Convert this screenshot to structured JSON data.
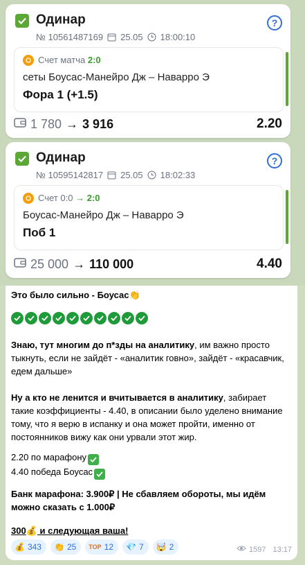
{
  "bets": [
    {
      "title": "Одинар",
      "number": "№ 10561487169",
      "date": "25.05",
      "time": "18:00:10",
      "score_label": "Счет матча",
      "score_value": "2:0",
      "event": "сеты Боусас-Манейро Дж – Наварро Э",
      "market": "Фора 1 (+1.5)",
      "stake": "1 780",
      "payout": "3 916",
      "odds": "2.20"
    },
    {
      "title": "Одинар",
      "number": "№ 10595142817",
      "date": "25.05",
      "time": "18:02:33",
      "score_label": "Счет",
      "score_from": "0:0",
      "score_value": "2:0",
      "event": "Боусас-Манейро Дж – Наварро Э",
      "market": "Поб 1",
      "stake": "25 000",
      "payout": "110 000",
      "odds": "4.40"
    }
  ],
  "message": {
    "line1": "Это было сильно - Боусас👏",
    "p1_bold": "Знаю, тут многим до п*зды на аналитику",
    "p1_rest": ", им важно просто тыкнуть, если не зайдёт - «аналитик говно», зайдёт - «красавчик, едем дальше»",
    "p2_bold": "Ну а кто не ленится и вчитывается в аналитику",
    "p2_rest": ", забирает такие коэффициенты - 4.40, в описании было уделено внимание тому, что я верю в испанку и она может пройти, именно от постоянников вижу как они урвали этот жир.",
    "marathon": "2.20 по марафону",
    "win": "4.40 победа Боусас",
    "bank": "Банк марафона: 3.900₽ | Не сбавляем обороты, мы идём можно сказать с 1.000₽",
    "cta_num": "300",
    "cta_text": " и следующая ваша!"
  },
  "reactions": [
    {
      "icon": "money-bag-icon",
      "count": "343"
    },
    {
      "icon": "clap-icon",
      "count": "25"
    },
    {
      "icon": "top-icon",
      "count": "12"
    },
    {
      "icon": "gem-icon",
      "count": "7"
    },
    {
      "icon": "exploding-head-icon",
      "count": "2"
    }
  ],
  "views": "1597",
  "msg_time": "13:17",
  "colors": {
    "accent": "#5ca837",
    "link": "#2f6fd6"
  }
}
